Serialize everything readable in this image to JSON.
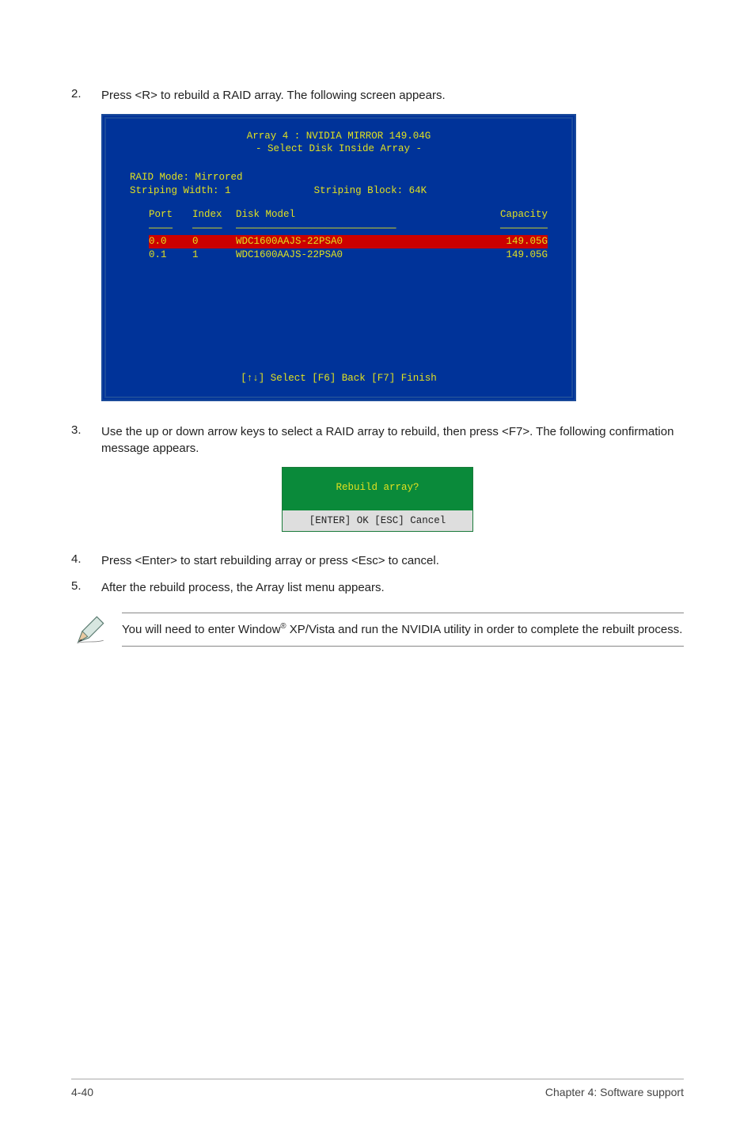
{
  "step2": {
    "num": "2.",
    "text": "Press <R> to rebuild a RAID array. The following screen appears."
  },
  "bios": {
    "title1": "Array 4 : NVIDIA MIRROR  149.04G",
    "title2": "- Select Disk Inside Array -",
    "mode_label": "RAID Mode: Mirrored",
    "width_label": "Striping Width: 1",
    "block_label": "Striping Block: 64K",
    "head_port": "Port",
    "head_index": "Index",
    "head_model": "Disk Model",
    "head_cap": "Capacity",
    "rows": [
      {
        "port": "0.0",
        "index": "0",
        "model": "WDC1600AAJS-22PSA0",
        "cap": "149.05G"
      },
      {
        "port": "0.1",
        "index": "1",
        "model": "WDC1600AAJS-22PSA0",
        "cap": "149.05G"
      }
    ],
    "footer": "[↑↓] Select  [F6] Back  [F7] Finish"
  },
  "step3": {
    "num": "3.",
    "text": "Use the up or down arrow keys to select a RAID array to rebuild, then press <F7>. The following confirmation message appears."
  },
  "dialog": {
    "question": "Rebuild array?",
    "buttons": "[ENTER] OK  [ESC] Cancel"
  },
  "step4": {
    "num": "4.",
    "text": "Press <Enter> to start rebuilding array or press <Esc> to cancel."
  },
  "step5": {
    "num": "5.",
    "text": "After the rebuild process, the Array list menu appears."
  },
  "note": {
    "pre": "You will need to enter Window",
    "sup": "®",
    "post": " XP/Vista and run the NVIDIA utility in order to complete the rebuilt process."
  },
  "footer": {
    "left": "4-40",
    "right": "Chapter 4: Software support"
  }
}
